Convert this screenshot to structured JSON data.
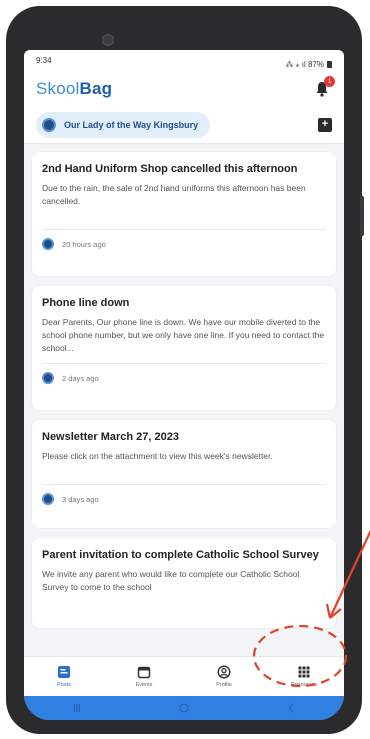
{
  "status_bar": {
    "time": "9:34",
    "indicators": "⁂ ⁎ ıl 87%"
  },
  "header": {
    "logo_light": "Skool",
    "logo_bold": "Bag",
    "notification_count": "1"
  },
  "school": {
    "name": "Our Lady of the Way Kingsbury"
  },
  "posts": [
    {
      "title": "2nd Hand Uniform Shop cancelled this afternoon",
      "body": "Due to the rain, the sale of 2nd hand uniforms this afternoon has been cancelled.",
      "time": "20 hours ago"
    },
    {
      "title": "Phone line down",
      "body": "Dear Parents,  Our phone line is down.  We have our mobile diverted to the school phone number, but we only have one line.  If you need to contact the school...",
      "time": "2 days ago"
    },
    {
      "title": "Newsletter March 27, 2023",
      "body": "Please click on the attachment to view this week's newsletter.",
      "time": "3 days ago"
    },
    {
      "title": "Parent invitation to complete Catholic School Survey",
      "body": "We invite any parent who would like to complete our Catholic School Survey to come to the school",
      "time": ""
    }
  ],
  "bottom_nav": [
    {
      "label": "Posts",
      "icon": "posts-icon",
      "active": true
    },
    {
      "label": "Events",
      "icon": "calendar-icon",
      "active": false
    },
    {
      "label": "Profile",
      "icon": "profile-icon",
      "active": false
    },
    {
      "label": "Resources",
      "icon": "grid-icon",
      "active": false
    }
  ],
  "colors": {
    "brand_blue": "#1e5fa8",
    "logo_light_blue": "#3a8fd8",
    "system_bar_blue": "#2f80e0",
    "annotation_red": "#e0452b",
    "badge_red": "#e53935"
  }
}
